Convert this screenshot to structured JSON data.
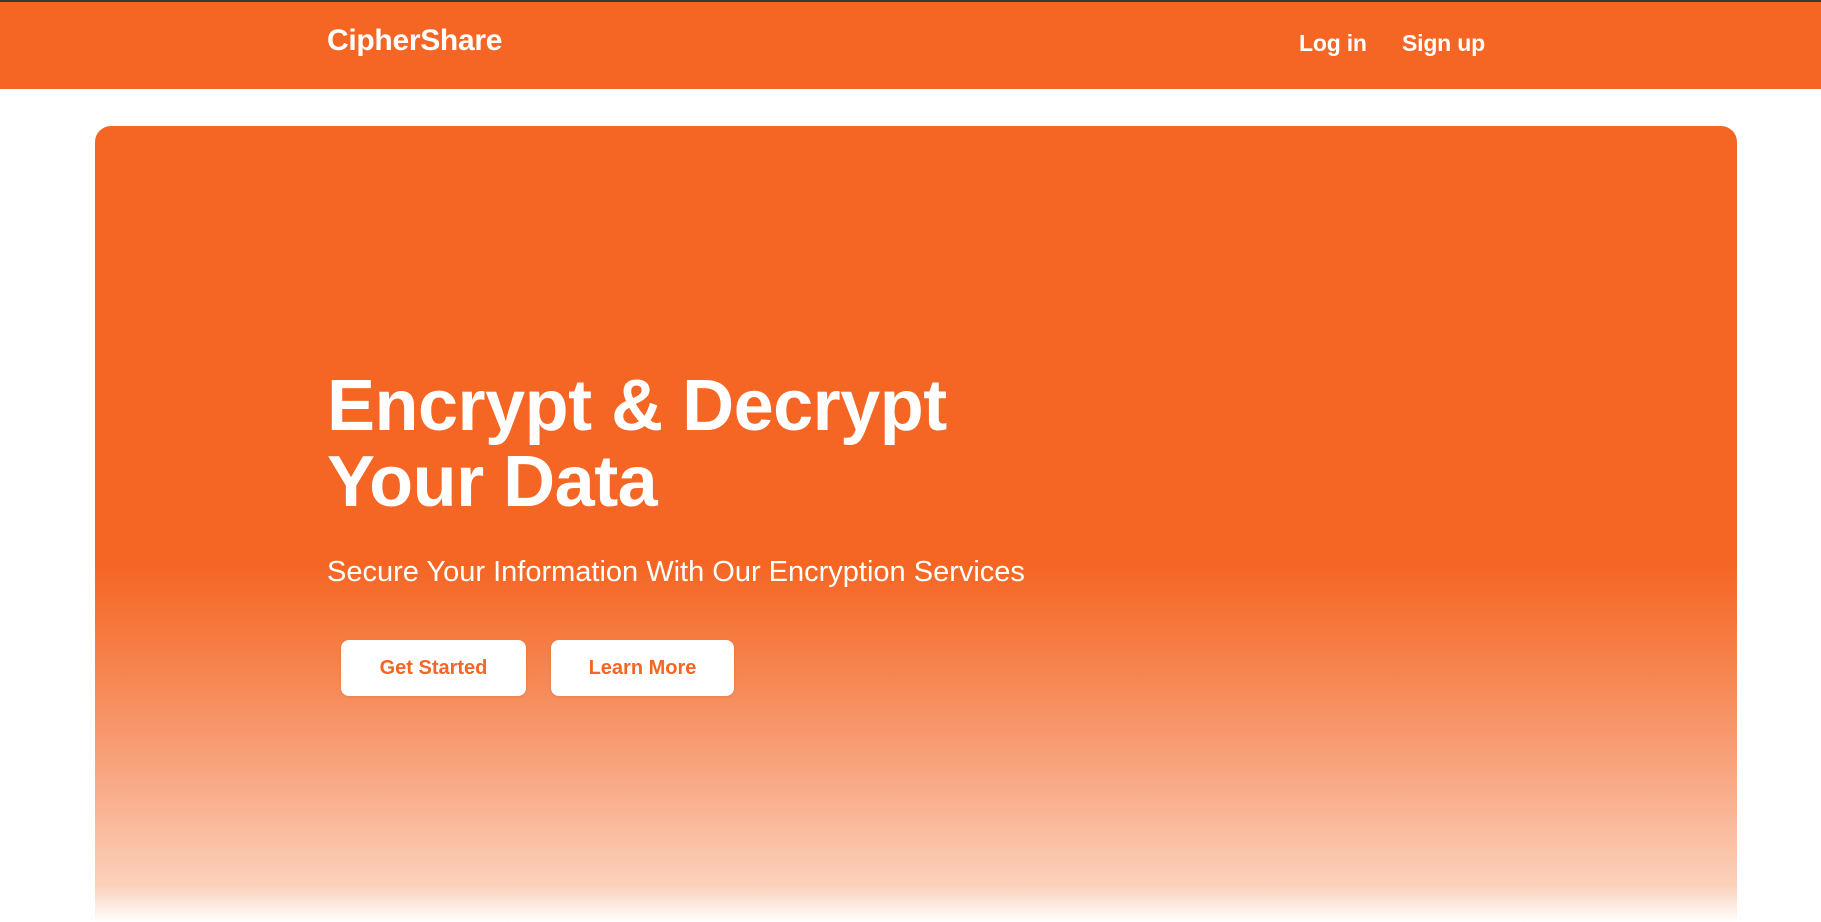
{
  "navbar": {
    "brand": "CipherShare",
    "links": [
      {
        "label": "Log in"
      },
      {
        "label": "Sign up"
      }
    ]
  },
  "hero": {
    "title_line1": "Encrypt & Decrypt",
    "title_line2": "Your Data",
    "subtitle": "Secure Your Information With Our Encryption Services",
    "buttons": {
      "get_started": "Get Started",
      "learn_more": "Learn More"
    }
  },
  "colors": {
    "accent": "#f56624",
    "text_on_accent": "#ffffff",
    "background": "#ffffff"
  }
}
